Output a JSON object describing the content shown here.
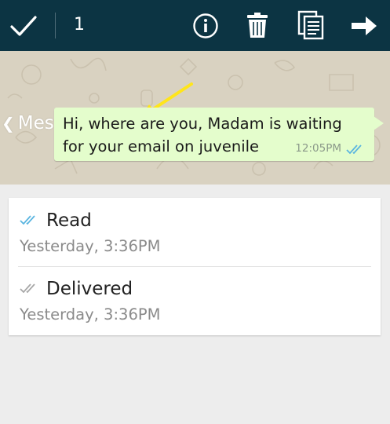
{
  "actionbar": {
    "selected_count": "1",
    "icons": [
      "check-icon",
      "info-icon",
      "trash-icon",
      "copy-icon",
      "forward-icon"
    ]
  },
  "header": {
    "title": "Message info"
  },
  "message": {
    "text": "Hi, where are you, Madam is waiting for your email on juvenile",
    "time": "12:05PM"
  },
  "statuses": [
    {
      "label": "Read",
      "time": "Yesterday, 3:36PM",
      "tick_color": "#5ab5e0"
    },
    {
      "label": "Delivered",
      "time": "Yesterday, 3:36PM",
      "tick_color": "#a7a7a7"
    }
  ],
  "colors": {
    "actionbar_bg": "#0c3443",
    "bubble_bg": "#e4fdcc",
    "annotation_arrow": "#ffe51a"
  }
}
